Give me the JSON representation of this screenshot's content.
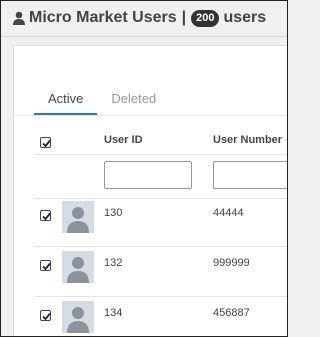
{
  "header": {
    "title": "Micro Market Users",
    "count": "200",
    "count_suffix": "users"
  },
  "tabs": [
    {
      "label": "Active",
      "active": true
    },
    {
      "label": "Deleted",
      "active": false
    }
  ],
  "table": {
    "columns": [
      "User ID",
      "User Number"
    ],
    "rows": [
      {
        "selected": true,
        "user_id": "130",
        "user_number": "44444"
      },
      {
        "selected": true,
        "user_id": "132",
        "user_number": "999999"
      },
      {
        "selected": true,
        "user_id": "134",
        "user_number": "456887"
      }
    ]
  },
  "colors": {
    "accent": "#2a79c4",
    "badge_bg": "#333333"
  },
  "icons": {
    "header": "user-icon",
    "avatar": "user-avatar-icon",
    "checkbox": "checkmark-icon"
  }
}
